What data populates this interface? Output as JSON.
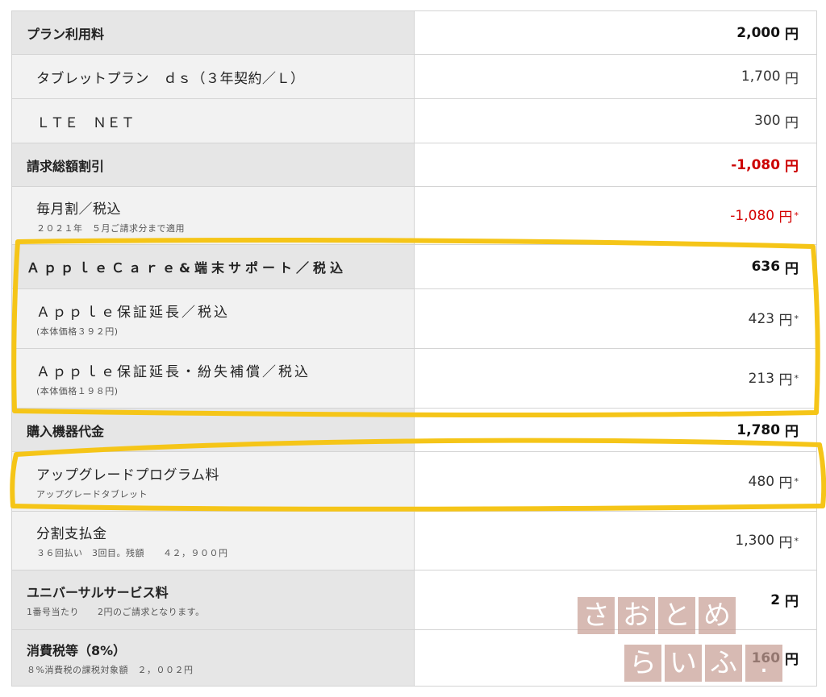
{
  "yen": "円",
  "rows": [
    {
      "kind": "section",
      "title": "プラン利用料",
      "value": "2,000"
    },
    {
      "kind": "sub",
      "title": "タブレットプラン　ｄｓ（３年契約／Ｌ）",
      "value": "1,700"
    },
    {
      "kind": "sub",
      "title": "ＬＴＥ　ＮＥＴ",
      "value": "300"
    },
    {
      "kind": "section",
      "title": "請求総額割引",
      "value": "-1,080"
    },
    {
      "kind": "sub",
      "title": "毎月割／税込",
      "note": "２０２１年　５月ご請求分まで適用",
      "value": "-1,080"
    },
    {
      "kind": "section",
      "title": "ＡｐｐｌｅＣａｒｅ&端末サポート／税込",
      "value": "636"
    },
    {
      "kind": "sub",
      "title": "Ａｐｐｌｅ保証延長／税込",
      "note": "(本体価格３９２円)",
      "value": "423"
    },
    {
      "kind": "sub",
      "title": "Ａｐｐｌｅ保証延長・紛失補償／税込",
      "note": "(本体価格１９８円)",
      "value": "213"
    },
    {
      "kind": "section",
      "title": "購入機器代金",
      "value": "1,780"
    },
    {
      "kind": "sub",
      "title": "アップグレードプログラム料",
      "note": "アップグレードタブレット",
      "value": "480"
    },
    {
      "kind": "sub",
      "title": "分割支払金",
      "note": "３６回払い　3回目。残額　　４２，９００円",
      "value": "1,300"
    },
    {
      "kind": "section",
      "title": "ユニバーサルサービス料",
      "note": "1番号当たり　　2円のご請求となります。",
      "value": "2"
    },
    {
      "kind": "section",
      "title": "消費税等（8%）",
      "note": "８%消費税の課税対象額　２，００２円",
      "value": "160"
    }
  ],
  "markers": {
    "star": "*"
  },
  "watermark": {
    "line1": [
      "さ",
      "お",
      "と",
      "め"
    ],
    "line2": [
      "ら",
      "い",
      "ふ",
      "."
    ]
  },
  "colors": {
    "highlight": "#f5c518",
    "negative": "#d40000",
    "section_bg": "#e6e6e6",
    "sub_bg": "#f2f2f2"
  }
}
